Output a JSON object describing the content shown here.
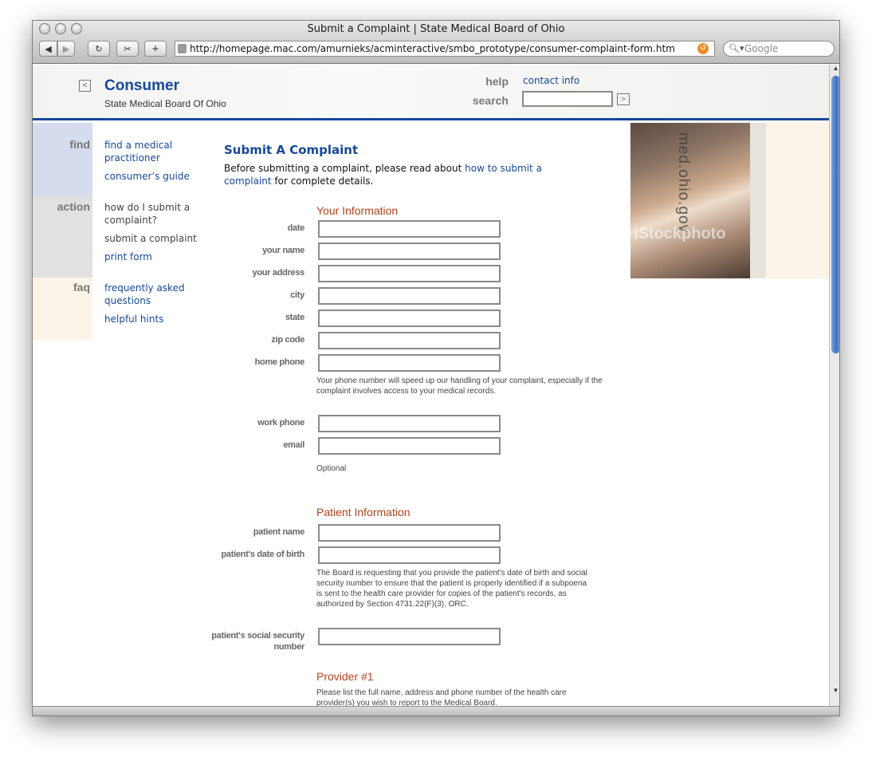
{
  "browser": {
    "title": "Submit a Complaint | State Medical Board of Ohio",
    "url": "http://homepage.mac.com/amurnieks/acminteractive/smbo_prototype/consumer-complaint-form.htm",
    "search_placeholder": "Google"
  },
  "header": {
    "brand": "Consumer",
    "subtitle": "State Medical Board Of Ohio",
    "help_label": "help",
    "search_label": "search",
    "contact_link": "contact info"
  },
  "nav": {
    "find": {
      "heading": "find",
      "items": [
        "find a medical practitioner",
        "consumer’s guide"
      ]
    },
    "action": {
      "heading": "action",
      "items": [
        "how do I submit a complaint?",
        "submit a complaint",
        "print form"
      ]
    },
    "faq": {
      "heading": "faq",
      "items": [
        "frequently asked questions",
        "helpful hints"
      ]
    }
  },
  "main": {
    "title": "Submit A Complaint",
    "intro_before": "Before submitting a complaint, please read about ",
    "intro_link": "how to submit a complaint",
    "intro_after": " for complete details."
  },
  "your_info": {
    "heading": "Your Information",
    "fields": {
      "date": "date",
      "name": "your name",
      "address": "your address",
      "city": "city",
      "state": "state",
      "zip": "zip code",
      "home_phone": "home phone",
      "work_phone": "work phone",
      "email": "email"
    },
    "phone_hint": "Your phone number will speed up our handling of your complaint, especially if the complaint involves access to your medical records.",
    "optional_hint": "Optional"
  },
  "patient_info": {
    "heading": "Patient Information",
    "fields": {
      "name": "patient name",
      "dob": "patient's date of birth",
      "ssn": "patient's social security number"
    },
    "dob_hint": "The Board is requesting that you provide the patient's date of birth and social security number to ensure that the patient is properly identified if a subpoena is sent to the health care provider for copies of the patient's records, as authorized by Section 4731.22(F)(3), ORC."
  },
  "provider": {
    "heading": "Provider #1",
    "hint": "Please list the full name, address and phone number of the health care provider(s) you wish to report to the Medical Board."
  },
  "photo": {
    "caption": "med.ohio.gov",
    "watermark": "iStockphoto"
  },
  "colors": {
    "brand_blue": "#17489b",
    "section_orange": "#b2431d",
    "find_band": "#d5dcee",
    "action_band": "#e1e1e1",
    "faq_band": "#fcf4e8"
  }
}
